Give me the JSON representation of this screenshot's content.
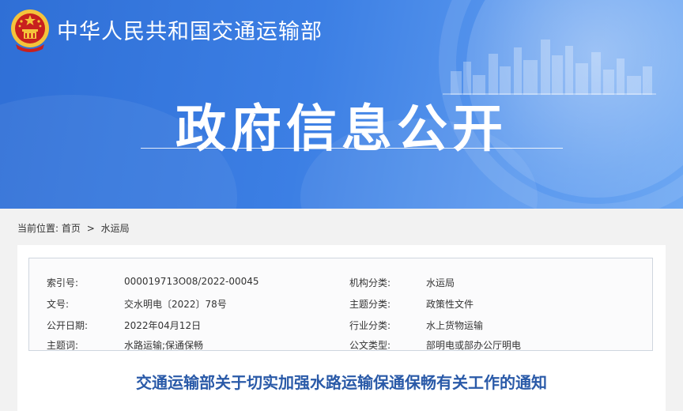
{
  "header": {
    "ministry_name": "中华人民共和国交通运输部",
    "portal_title": "政府信息公开",
    "emblem_icon": "national-emblem-icon"
  },
  "breadcrumb": {
    "label": "当前位置:",
    "items": [
      "首页",
      "水运局"
    ],
    "separator": ">"
  },
  "metadata": {
    "rows": [
      {
        "label1": "索引号:",
        "value1": "000019713O08/2022-00045",
        "label2": "机构分类:",
        "value2": "水运局"
      },
      {
        "label1": "文号:",
        "value1": "交水明电〔2022〕78号",
        "label2": "主题分类:",
        "value2": "政策性文件"
      },
      {
        "label1": "公开日期:",
        "value1": "2022年04月12日",
        "label2": "行业分类:",
        "value2": "水上货物运输"
      },
      {
        "label1": "主题词:",
        "value1": "水路运输;保通保畅",
        "label2": "公文类型:",
        "value2": "部明电或部办公厅明电"
      }
    ]
  },
  "document": {
    "title": "交通运输部关于切实加强水路运输保通保畅有关工作的通知"
  },
  "colors": {
    "banner_blue": "#3c7fe4",
    "title_blue": "#2a5aa8",
    "emblem_red": "#c8201e",
    "emblem_gold": "#f4c33b"
  }
}
